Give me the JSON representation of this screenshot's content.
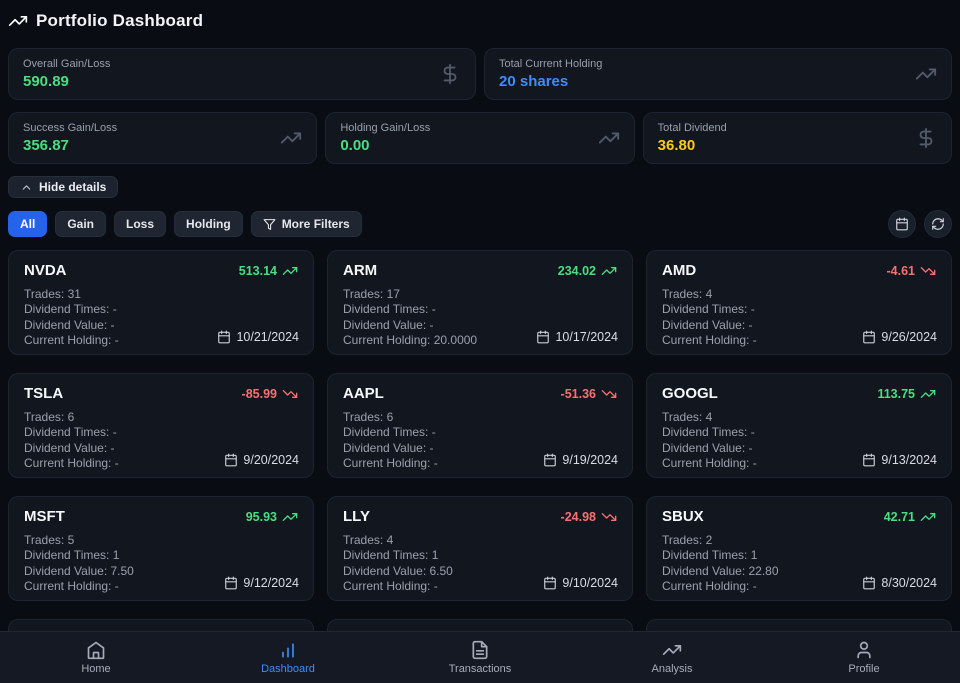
{
  "header": {
    "title": "Portfolio Dashboard"
  },
  "stats": [
    {
      "label": "Overall Gain/Loss",
      "value": "590.89",
      "tone": "green",
      "icon": "dollar"
    },
    {
      "label": "Total Current Holding",
      "value": "20 shares",
      "tone": "blue",
      "icon": "trend"
    },
    {
      "label": "Success Gain/Loss",
      "value": "356.87",
      "tone": "green",
      "icon": "trend"
    },
    {
      "label": "Holding Gain/Loss",
      "value": "0.00",
      "tone": "green",
      "icon": "trend"
    },
    {
      "label": "Total Dividend",
      "value": "36.80",
      "tone": "yellow",
      "icon": "dollar"
    }
  ],
  "controls": {
    "hide_details_label": "Hide details",
    "filters": [
      {
        "label": "All",
        "active": true
      },
      {
        "label": "Gain",
        "active": false
      },
      {
        "label": "Loss",
        "active": false
      },
      {
        "label": "Holding",
        "active": false
      }
    ],
    "more_filters_label": "More Filters"
  },
  "card_labels": {
    "trades": "Trades:",
    "dividend_times": "Dividend Times:",
    "dividend_value": "Dividend Value:",
    "current_holding": "Current Holding:"
  },
  "cards": [
    {
      "symbol": "NVDA",
      "change": "513.14",
      "direction": "up",
      "trades": "31",
      "dividend_times": "-",
      "dividend_value": "-",
      "current_holding": "-",
      "date": "10/21/2024"
    },
    {
      "symbol": "ARM",
      "change": "234.02",
      "direction": "up",
      "trades": "17",
      "dividend_times": "-",
      "dividend_value": "-",
      "current_holding": "20.0000",
      "date": "10/17/2024"
    },
    {
      "symbol": "AMD",
      "change": "-4.61",
      "direction": "down",
      "trades": "4",
      "dividend_times": "-",
      "dividend_value": "-",
      "current_holding": "-",
      "date": "9/26/2024"
    },
    {
      "symbol": "TSLA",
      "change": "-85.99",
      "direction": "down",
      "trades": "6",
      "dividend_times": "-",
      "dividend_value": "-",
      "current_holding": "-",
      "date": "9/20/2024"
    },
    {
      "symbol": "AAPL",
      "change": "-51.36",
      "direction": "down",
      "trades": "6",
      "dividend_times": "-",
      "dividend_value": "-",
      "current_holding": "-",
      "date": "9/19/2024"
    },
    {
      "symbol": "GOOGL",
      "change": "113.75",
      "direction": "up",
      "trades": "4",
      "dividend_times": "-",
      "dividend_value": "-",
      "current_holding": "-",
      "date": "9/13/2024"
    },
    {
      "symbol": "MSFT",
      "change": "95.93",
      "direction": "up",
      "trades": "5",
      "dividend_times": "1",
      "dividend_value": "7.50",
      "current_holding": "-",
      "date": "9/12/2024"
    },
    {
      "symbol": "LLY",
      "change": "-24.98",
      "direction": "down",
      "trades": "4",
      "dividend_times": "1",
      "dividend_value": "6.50",
      "current_holding": "-",
      "date": "9/10/2024"
    },
    {
      "symbol": "SBUX",
      "change": "42.71",
      "direction": "up",
      "trades": "2",
      "dividend_times": "1",
      "dividend_value": "22.80",
      "current_holding": "-",
      "date": "8/30/2024"
    }
  ],
  "nav": {
    "items": [
      {
        "label": "Home",
        "icon": "home",
        "active": false
      },
      {
        "label": "Dashboard",
        "icon": "chart",
        "active": true
      },
      {
        "label": "Transactions",
        "icon": "file",
        "active": false
      },
      {
        "label": "Analysis",
        "icon": "trend",
        "active": false
      },
      {
        "label": "Profile",
        "icon": "user",
        "active": false
      }
    ]
  },
  "colors": {
    "accent_blue": "#2563eb",
    "holding_blue": "#3f8cfa",
    "gain_green": "#4ade80",
    "loss_red": "#f87171",
    "dividend_yellow": "#facc15"
  }
}
